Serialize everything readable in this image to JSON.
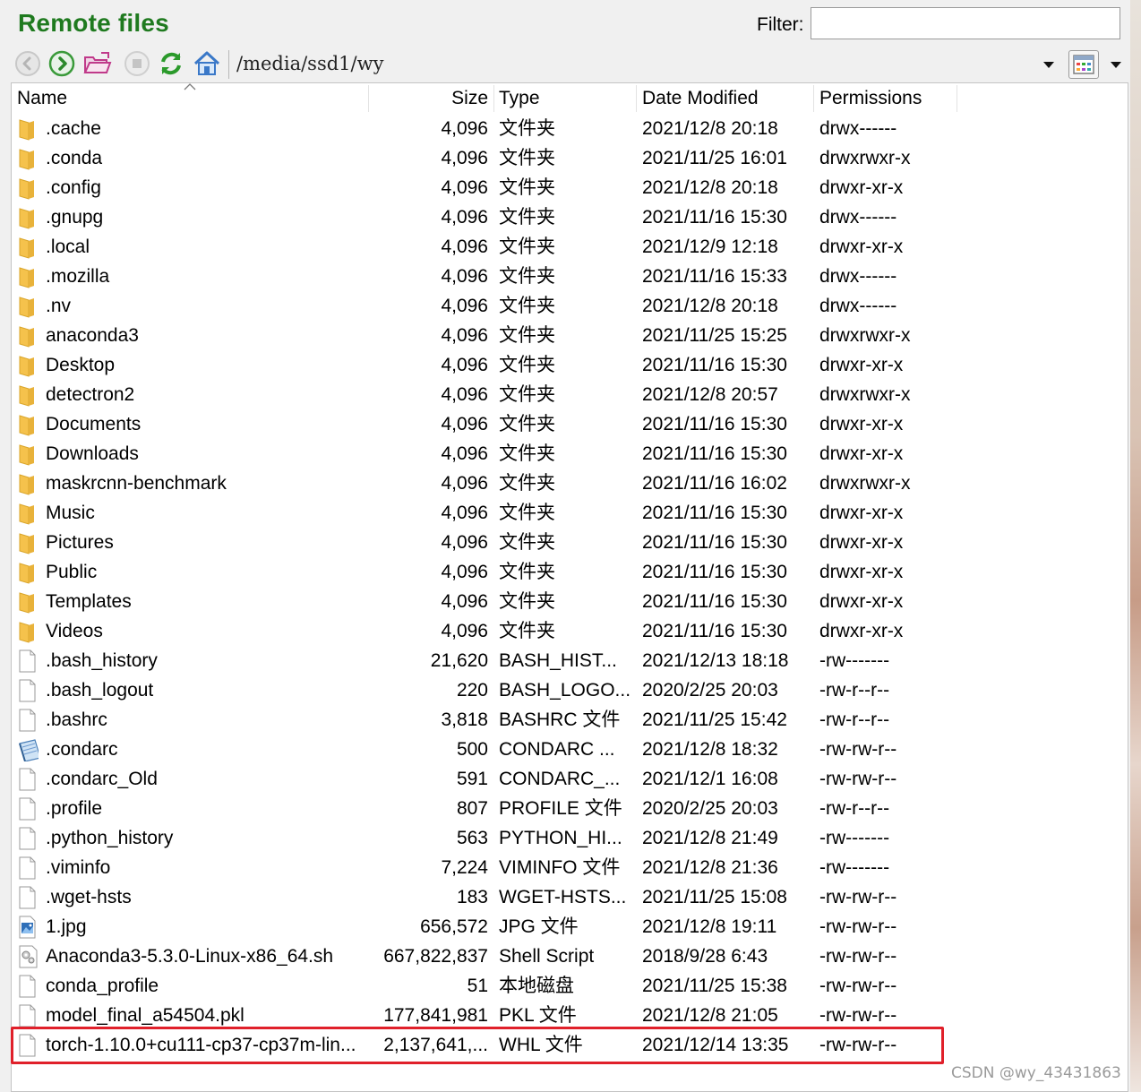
{
  "title": "Remote files",
  "filter": {
    "label": "Filter:",
    "value": ""
  },
  "path": "/media/ssd1/wy",
  "columns": {
    "name": "Name",
    "size": "Size",
    "type": "Type",
    "date": "Date Modified",
    "perm": "Permissions"
  },
  "files": [
    {
      "icon": "folder",
      "name": ".cache",
      "size": "4,096",
      "type": "文件夹",
      "date": "2021/12/8 20:18",
      "perm": "drwx------"
    },
    {
      "icon": "folder",
      "name": ".conda",
      "size": "4,096",
      "type": "文件夹",
      "date": "2021/11/25 16:01",
      "perm": "drwxrwxr-x"
    },
    {
      "icon": "folder",
      "name": ".config",
      "size": "4,096",
      "type": "文件夹",
      "date": "2021/12/8 20:18",
      "perm": "drwxr-xr-x"
    },
    {
      "icon": "folder",
      "name": ".gnupg",
      "size": "4,096",
      "type": "文件夹",
      "date": "2021/11/16 15:30",
      "perm": "drwx------"
    },
    {
      "icon": "folder",
      "name": ".local",
      "size": "4,096",
      "type": "文件夹",
      "date": "2021/12/9 12:18",
      "perm": "drwxr-xr-x"
    },
    {
      "icon": "folder",
      "name": ".mozilla",
      "size": "4,096",
      "type": "文件夹",
      "date": "2021/11/16 15:33",
      "perm": "drwx------"
    },
    {
      "icon": "folder",
      "name": ".nv",
      "size": "4,096",
      "type": "文件夹",
      "date": "2021/12/8 20:18",
      "perm": "drwx------"
    },
    {
      "icon": "folder",
      "name": "anaconda3",
      "size": "4,096",
      "type": "文件夹",
      "date": "2021/11/25 15:25",
      "perm": "drwxrwxr-x"
    },
    {
      "icon": "folder",
      "name": "Desktop",
      "size": "4,096",
      "type": "文件夹",
      "date": "2021/11/16 15:30",
      "perm": "drwxr-xr-x"
    },
    {
      "icon": "folder",
      "name": "detectron2",
      "size": "4,096",
      "type": "文件夹",
      "date": "2021/12/8 20:57",
      "perm": "drwxrwxr-x"
    },
    {
      "icon": "folder",
      "name": "Documents",
      "size": "4,096",
      "type": "文件夹",
      "date": "2021/11/16 15:30",
      "perm": "drwxr-xr-x"
    },
    {
      "icon": "folder",
      "name": "Downloads",
      "size": "4,096",
      "type": "文件夹",
      "date": "2021/11/16 15:30",
      "perm": "drwxr-xr-x"
    },
    {
      "icon": "folder",
      "name": "maskrcnn-benchmark",
      "size": "4,096",
      "type": "文件夹",
      "date": "2021/11/16 16:02",
      "perm": "drwxrwxr-x"
    },
    {
      "icon": "folder",
      "name": "Music",
      "size": "4,096",
      "type": "文件夹",
      "date": "2021/11/16 15:30",
      "perm": "drwxr-xr-x"
    },
    {
      "icon": "folder",
      "name": "Pictures",
      "size": "4,096",
      "type": "文件夹",
      "date": "2021/11/16 15:30",
      "perm": "drwxr-xr-x"
    },
    {
      "icon": "folder",
      "name": "Public",
      "size": "4,096",
      "type": "文件夹",
      "date": "2021/11/16 15:30",
      "perm": "drwxr-xr-x"
    },
    {
      "icon": "folder",
      "name": "Templates",
      "size": "4,096",
      "type": "文件夹",
      "date": "2021/11/16 15:30",
      "perm": "drwxr-xr-x"
    },
    {
      "icon": "folder",
      "name": "Videos",
      "size": "4,096",
      "type": "文件夹",
      "date": "2021/11/16 15:30",
      "perm": "drwxr-xr-x"
    },
    {
      "icon": "file",
      "name": ".bash_history",
      "size": "21,620",
      "type": "BASH_HIST...",
      "date": "2021/12/13 18:18",
      "perm": "-rw-------"
    },
    {
      "icon": "file",
      "name": ".bash_logout",
      "size": "220",
      "type": "BASH_LOGO...",
      "date": "2020/2/25 20:03",
      "perm": "-rw-r--r--"
    },
    {
      "icon": "file",
      "name": ".bashrc",
      "size": "3,818",
      "type": "BASHRC 文件",
      "date": "2021/11/25 15:42",
      "perm": "-rw-r--r--"
    },
    {
      "icon": "notepad",
      "name": ".condarc",
      "size": "500",
      "type": "CONDARC ...",
      "date": "2021/12/8 18:32",
      "perm": "-rw-rw-r--"
    },
    {
      "icon": "file",
      "name": ".condarc_Old",
      "size": "591",
      "type": "CONDARC_...",
      "date": "2021/12/1 16:08",
      "perm": "-rw-rw-r--"
    },
    {
      "icon": "file",
      "name": ".profile",
      "size": "807",
      "type": "PROFILE 文件",
      "date": "2020/2/25 20:03",
      "perm": "-rw-r--r--"
    },
    {
      "icon": "file",
      "name": ".python_history",
      "size": "563",
      "type": "PYTHON_HI...",
      "date": "2021/12/8 21:49",
      "perm": "-rw-------"
    },
    {
      "icon": "file",
      "name": ".viminfo",
      "size": "7,224",
      "type": "VIMINFO 文件",
      "date": "2021/12/8 21:36",
      "perm": "-rw-------"
    },
    {
      "icon": "file",
      "name": ".wget-hsts",
      "size": "183",
      "type": "WGET-HSTS...",
      "date": "2021/11/25 15:08",
      "perm": "-rw-rw-r--"
    },
    {
      "icon": "image",
      "name": "1.jpg",
      "size": "656,572",
      "type": "JPG 文件",
      "date": "2021/12/8 19:11",
      "perm": "-rw-rw-r--"
    },
    {
      "icon": "script",
      "name": "Anaconda3-5.3.0-Linux-x86_64.sh",
      "size": "667,822,837",
      "type": "Shell Script",
      "date": "2018/9/28 6:43",
      "perm": "-rw-rw-r--"
    },
    {
      "icon": "file",
      "name": "conda_profile",
      "size": "51",
      "type": "本地磁盘",
      "date": "2021/11/25 15:38",
      "perm": "-rw-rw-r--"
    },
    {
      "icon": "file",
      "name": "model_final_a54504.pkl",
      "size": "177,841,981",
      "type": "PKL 文件",
      "date": "2021/12/8 21:05",
      "perm": "-rw-rw-r--"
    },
    {
      "icon": "file",
      "name": "torch-1.10.0+cu111-cp37-cp37m-lin...",
      "size": "2,137,641,...",
      "type": "WHL 文件",
      "date": "2021/12/14 13:35",
      "perm": "-rw-rw-r--"
    }
  ],
  "watermark": "CSDN @wy_43431863",
  "colors": {
    "title": "#1f7a1f",
    "folder": "#f2c14e",
    "highlight": "#e0202a"
  }
}
